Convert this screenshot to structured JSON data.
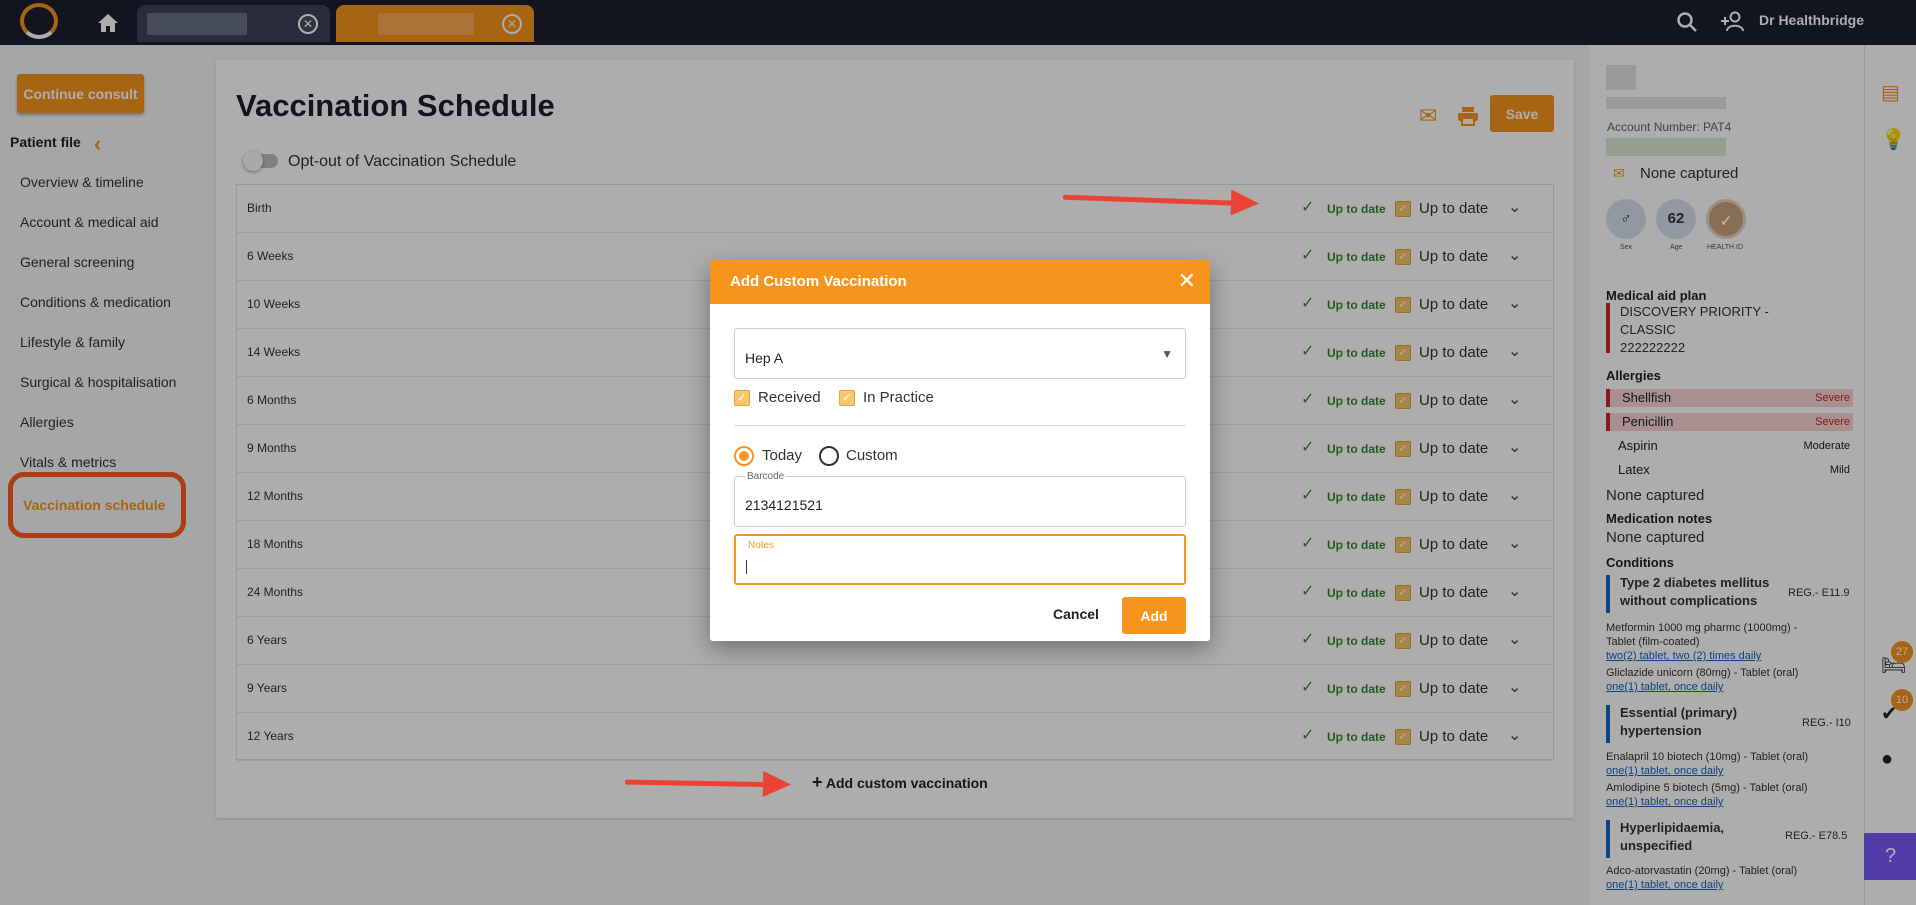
{
  "app": {
    "user_name": "Dr Healthbridge"
  },
  "nav": {
    "continue_consult": "Continue consult",
    "patient_file": "Patient file",
    "items": [
      "Overview & timeline",
      "Account & medical aid",
      "General screening",
      "Conditions & medication",
      "Lifestyle & family",
      "Surgical & hospitalisation",
      "Allergies",
      "Vitals & metrics",
      "Vaccination schedule"
    ]
  },
  "main": {
    "title": "Vaccination Schedule",
    "opt_out_label": "Opt-out of Vaccination Schedule",
    "save_label": "Save",
    "add_custom_label": "Add custom vaccination",
    "status_label": "Up to date",
    "rows": [
      "Birth",
      "6 Weeks",
      "10 Weeks",
      "14 Weeks",
      "6 Months",
      "9 Months",
      "12 Months",
      "18 Months",
      "24 Months",
      "6 Years",
      "9 Years",
      "12 Years"
    ]
  },
  "modal": {
    "title": "Add Custom Vaccination",
    "vaccine_value": "Hep A",
    "received_label": "Received",
    "in_practice_label": "In Practice",
    "today_label": "Today",
    "custom_label": "Custom",
    "barcode_label": "Barcode",
    "barcode_value": "2134121521",
    "notes_label": "Notes",
    "notes_value": "",
    "cancel_label": "Cancel",
    "add_label": "Add"
  },
  "patient": {
    "account_number": "Account Number: PAT4",
    "contact": "None captured",
    "sex_label": "Sex",
    "age_value": "62",
    "age_label": "Age",
    "health_id_label": "HEALTH ID",
    "medical_aid_heading": "Medical aid plan",
    "medical_aid_plan": [
      "DISCOVERY PRIORITY -",
      "CLASSIC",
      "222222222"
    ],
    "allergies_heading": "Allergies",
    "allergies": [
      {
        "name": "Shellfish",
        "severity": "Severe"
      },
      {
        "name": "Penicillin",
        "severity": "Severe"
      },
      {
        "name": "Aspirin",
        "severity": "Moderate"
      },
      {
        "name": "Latex",
        "severity": "Mild"
      }
    ],
    "allergies_none": "None captured",
    "medication_notes_heading": "Medication notes",
    "medication_notes": "None captured",
    "conditions_heading": "Conditions",
    "conditions": [
      {
        "name": [
          "Type 2 diabetes mellitus",
          "without complications"
        ],
        "code": "REG.- E11.9",
        "meds": [
          {
            "name": [
              "Metformin 1000 mg pharmc (1000mg) -",
              "Tablet (film-coated)"
            ],
            "dose": "two(2) tablet, two (2) times daily"
          },
          {
            "name": [
              "Gliclazide unicorn (80mg) - Tablet (oral)"
            ],
            "dose": "one(1) tablet, once daily"
          }
        ]
      },
      {
        "name": [
          "Essential (primary)",
          "hypertension"
        ],
        "code": "REG.- I10",
        "meds": [
          {
            "name": [
              "Enalapril 10 biotech (10mg) - Tablet (oral)"
            ],
            "dose": "one(1) tablet, once daily"
          },
          {
            "name": [
              "Amlodipine 5 biotech (5mg) - Tablet (oral)"
            ],
            "dose": "one(1) tablet, once daily"
          }
        ]
      },
      {
        "name": [
          "Hyperlipidaemia,",
          "unspecified"
        ],
        "code": "REG.- E78.5",
        "meds": [
          {
            "name": [
              "Adco-atorvastatin (20mg) - Tablet (oral)"
            ],
            "dose": "one(1) tablet, once daily"
          }
        ]
      }
    ]
  },
  "rail": {
    "badge_1": "27",
    "badge_2": "10"
  },
  "colors": {
    "accent": "#f7941d",
    "topbar": "#1b1f2e",
    "ok": "#2e8b2e",
    "highlight": "#ff5a1f",
    "arrow": "#ea4335"
  }
}
